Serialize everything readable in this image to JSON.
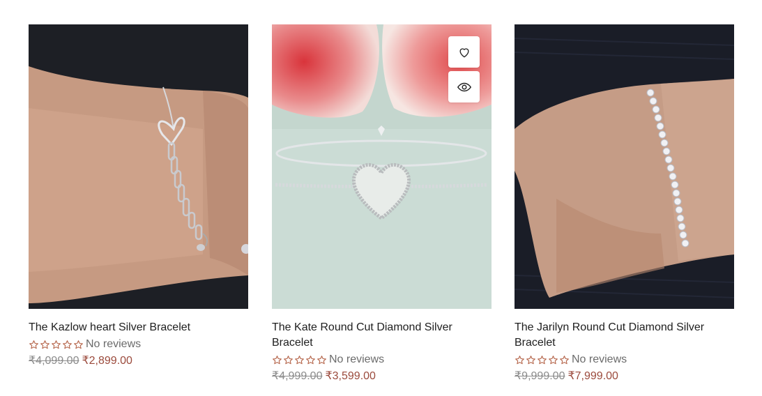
{
  "products": [
    {
      "title": "The Kazlow heart Silver Bracelet",
      "reviews_label": "No reviews",
      "rating": 0,
      "compare_price": "₹4,099.00",
      "price": "₹2,899.00"
    },
    {
      "title": "The Kate Round Cut Diamond Silver Bracelet",
      "reviews_label": "No reviews",
      "rating": 0,
      "compare_price": "₹4,999.00",
      "price": "₹3,599.00",
      "actions": [
        "heart-icon",
        "eye-icon"
      ]
    },
    {
      "title": "The Jarilyn Round Cut Diamond Silver Bracelet",
      "reviews_label": "No reviews",
      "rating": 0,
      "compare_price": "₹9,999.00",
      "price": "₹7,999.00"
    }
  ],
  "colors": {
    "star": "#b5654a",
    "sale_price": "#9b4a3c",
    "compare_price": "#8b8b8b"
  }
}
